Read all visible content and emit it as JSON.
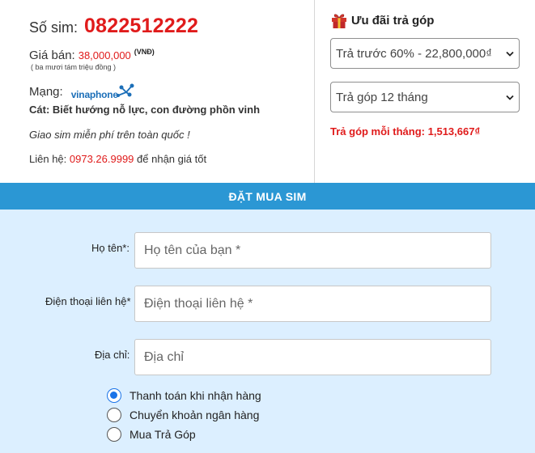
{
  "sim": {
    "label": "Số sim:",
    "number": "0822512222",
    "price_label": "Giá bán:",
    "price_value": "38,000,000",
    "price_unit": "(VNĐ)",
    "price_words": "( ba mươi tám triệu đồng )",
    "network_label": "Mạng:",
    "network_name": "vinaphone",
    "meaning": "Cát: Biết hướng nỗ lực, con đường phồn vinh",
    "free_shipping": "Giao sim miễn phí trên toàn quốc !",
    "contact_prefix": "Liên hệ:",
    "contact_phone": "0973.26.9999",
    "contact_suffix": "để nhận giá tốt"
  },
  "installment": {
    "title": "Ưu đãi trả góp",
    "prepay_selected": "Trả trước 60% - 22,800,000₫",
    "term_selected": "Trả góp 12 tháng",
    "monthly_label": "Trả góp mỗi tháng:",
    "monthly_value": "1,513,667₫"
  },
  "order": {
    "header": "ĐẶT MUA SIM",
    "name_label": "Họ tên*:",
    "name_placeholder": "Họ tên của bạn *",
    "phone_label": "Điện thoại liên hệ*",
    "phone_placeholder": "Điện thoại liên hệ *",
    "address_label": "Địa chỉ:",
    "address_placeholder": "Địa chỉ",
    "payment_options": [
      "Thanh toán khi nhận hàng",
      "Chuyển khoản ngân hàng",
      "Mua Trả Góp"
    ],
    "payment_selected": "Thanh toán khi nhận hàng"
  },
  "colors": {
    "accent_red": "#e01b1b",
    "header_blue": "#2b97d4",
    "form_bg": "#dcefff",
    "vinaphone_blue": "#1c6fb8"
  },
  "icons": {
    "promo": "gift-icon",
    "select_arrow": "chevron-down-icon",
    "network": "vinaphone-logo"
  }
}
